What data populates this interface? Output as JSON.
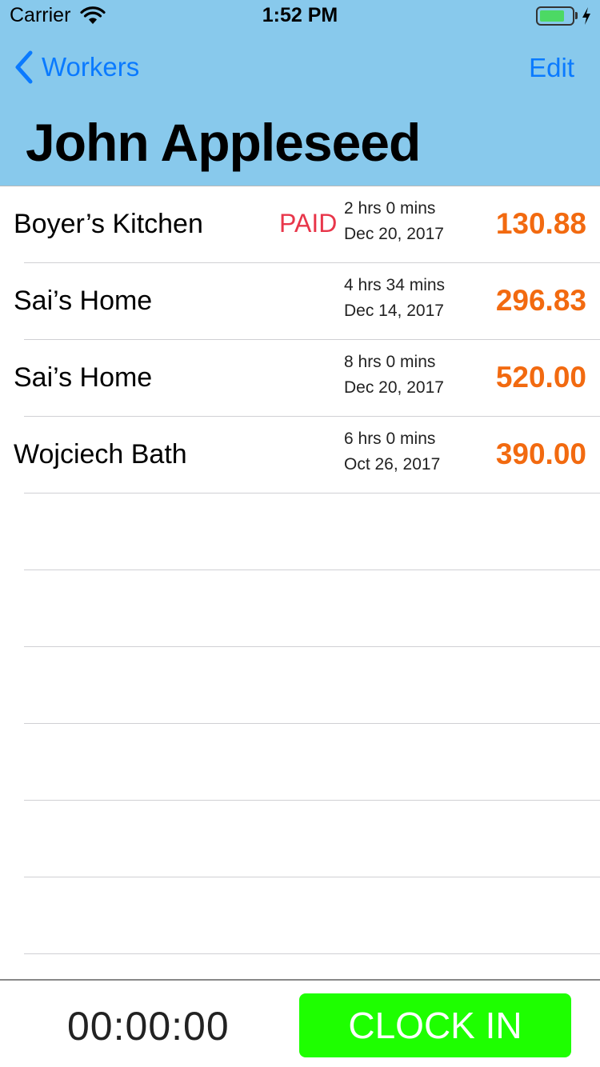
{
  "status_bar": {
    "carrier": "Carrier",
    "time": "1:52 PM",
    "battery_color": "#4cd964"
  },
  "nav": {
    "back_label": "Workers",
    "edit_label": "Edit",
    "title": "John Appleseed",
    "accent": "#0a7aff",
    "background": "#88c9ec"
  },
  "jobs": [
    {
      "name": "Boyer’s Kitchen",
      "status": "PAID",
      "duration": "2 hrs 0 mins",
      "date": "Dec 20, 2017",
      "amount": "130.88"
    },
    {
      "name": "Sai’s Home",
      "status": "",
      "duration": "4 hrs 34 mins",
      "date": "Dec 14, 2017",
      "amount": "296.83"
    },
    {
      "name": "Sai’s Home",
      "status": "",
      "duration": "8 hrs 0 mins",
      "date": "Dec 20, 2017",
      "amount": "520.00"
    },
    {
      "name": "Wojciech Bath",
      "status": "",
      "duration": "6 hrs 0 mins",
      "date": "Oct 26, 2017",
      "amount": "390.00"
    }
  ],
  "bottom": {
    "timer": "00:00:00",
    "clock_in_label": "CLOCK IN",
    "clock_in_color": "#1eff00"
  },
  "icons": {
    "back": "chevron-left-icon",
    "wifi": "wifi-icon",
    "battery": "battery-icon",
    "charging": "bolt-icon"
  }
}
